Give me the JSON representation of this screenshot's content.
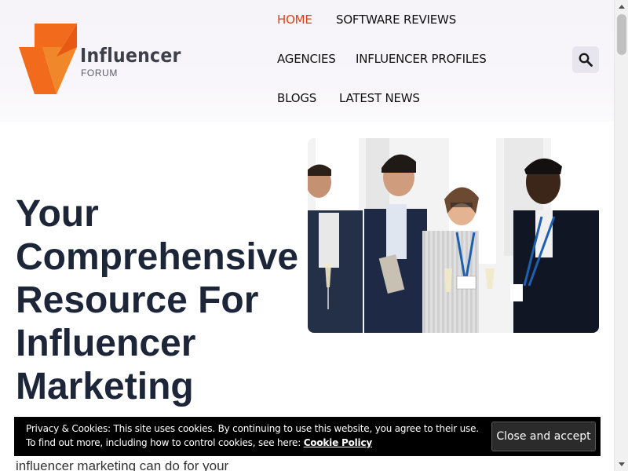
{
  "brand": {
    "name": "Influencer",
    "tagline": "FORUM",
    "colors": {
      "accent_orange": "#f26b1d",
      "accent_dark_orange": "#d9441a",
      "heading": "#1c2638"
    }
  },
  "nav": {
    "items": [
      {
        "label": "HOME",
        "active": true
      },
      {
        "label": "SOFTWARE REVIEWS",
        "active": false
      },
      {
        "label": "AGENCIES",
        "active": false
      },
      {
        "label": "INFLUENCER PROFILES",
        "active": false
      },
      {
        "label": "BLOGS",
        "active": false
      },
      {
        "label": "LATEST NEWS",
        "active": false
      }
    ],
    "search_icon": "search-icon"
  },
  "hero": {
    "title_lines": [
      "Your",
      "Comprehensive",
      "Resource For",
      "Influencer",
      "Marketing"
    ],
    "image_icon": "business-people-networking-photo",
    "body_partial": "influencer marketing can do for your"
  },
  "cookie": {
    "line1": "Privacy & Cookies: This site uses cookies. By continuing to use this website, you agree to their use.",
    "line2_prefix": "To find out more, including how to control cookies, see here: ",
    "link_label": "Cookie Policy",
    "button_label": "Close and accept"
  }
}
